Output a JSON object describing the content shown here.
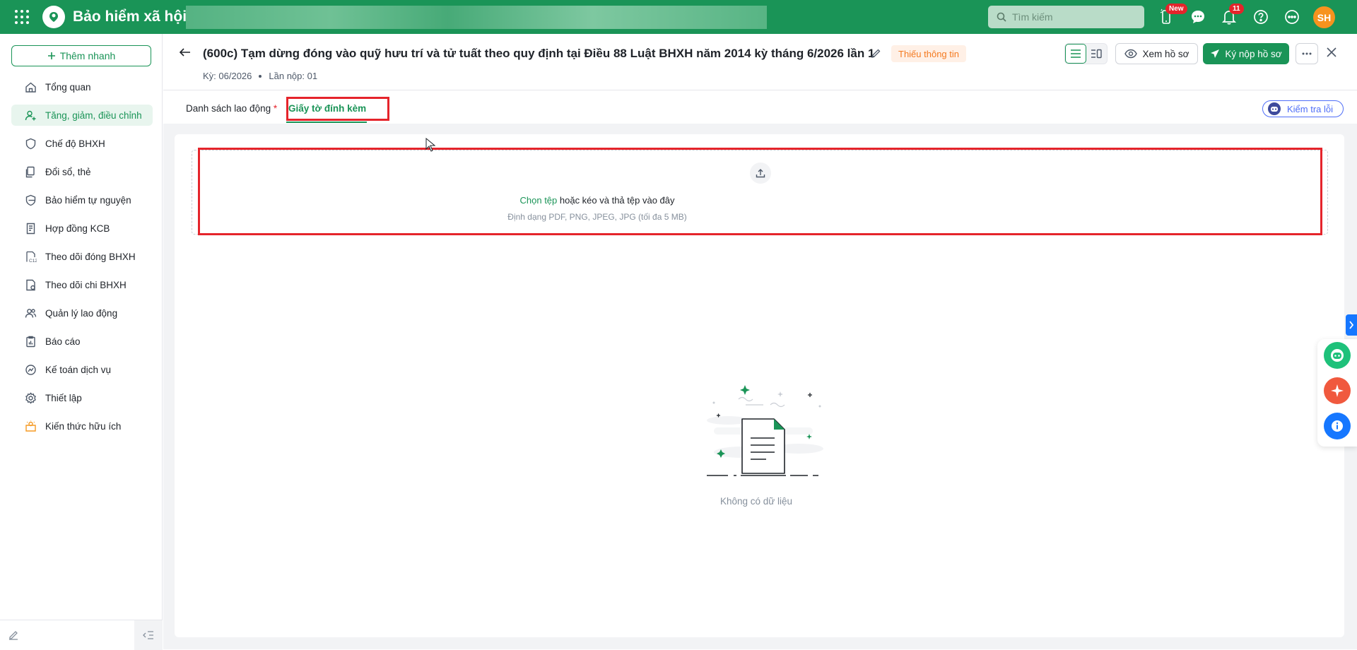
{
  "topbar": {
    "app_title": "Bảo hiểm xã hội",
    "search_placeholder": "Tìm kiếm",
    "new_badge": "New",
    "notification_count": "11",
    "avatar_initials": "SH",
    "brand_color": "#1a9457"
  },
  "sidebar": {
    "quick_add_label": "Thêm nhanh",
    "items": [
      {
        "label": "Tổng quan",
        "icon": "home-icon"
      },
      {
        "label": "Tăng, giảm, điều chỉnh",
        "icon": "user-add-icon",
        "active": true
      },
      {
        "label": "Chế độ BHXH",
        "icon": "shield-icon"
      },
      {
        "label": "Đổi sổ, thẻ",
        "icon": "card-swap-icon"
      },
      {
        "label": "Bảo hiểm tự nguyện",
        "icon": "shield-heart-icon"
      },
      {
        "label": "Hợp đồng KCB",
        "icon": "contract-icon"
      },
      {
        "label": "Theo dõi đóng BHXH",
        "icon": "c12-document-icon"
      },
      {
        "label": "Theo dõi chi BHXH",
        "icon": "document-money-icon"
      },
      {
        "label": "Quản lý lao động",
        "icon": "users-icon"
      },
      {
        "label": "Báo cáo",
        "icon": "report-icon"
      },
      {
        "label": "Kế toán dịch vụ",
        "icon": "accounting-icon"
      },
      {
        "label": "Thiết lập",
        "icon": "gear-icon"
      },
      {
        "label": "Kiến thức hữu ích",
        "icon": "knowledge-icon"
      }
    ]
  },
  "header": {
    "title": "(600c) Tạm dừng đóng vào quỹ hưu trí và tử tuất theo quy định tại Điều 88 Luật BHXH năm 2014 kỳ tháng 6/2026 lần 1",
    "status": "Thiếu thông tin",
    "period": "Kỳ: 06/2026",
    "submission": "Lần nộp: 01",
    "view_label": "Xem hồ sơ",
    "sign_label": "Ký nộp hồ sơ"
  },
  "tabs": {
    "employees": "Danh sách lao động",
    "required_mark": "*",
    "attachments": "Giấy tờ đính kèm",
    "check_errors": "Kiểm tra lỗi"
  },
  "dropzone": {
    "choose_file": "Chọn tệp",
    "drag_text": " hoặc kéo và thả tệp vào đây",
    "formats": "Định dạng PDF, PNG, JPEG, JPG (tối đa 5 MB)"
  },
  "empty": {
    "message": "Không có dữ liệu"
  }
}
